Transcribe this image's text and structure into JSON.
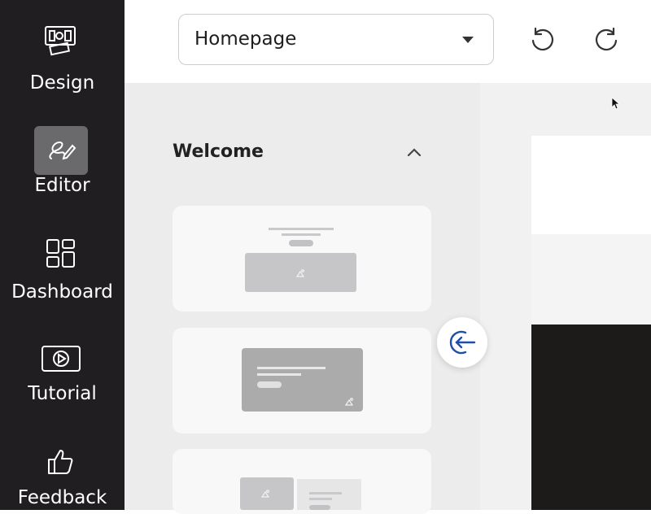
{
  "sidebar": {
    "items": [
      {
        "label": "Design",
        "icon": "design-icon",
        "active": false
      },
      {
        "label": "Editor",
        "icon": "editor-pen-icon",
        "active": true
      },
      {
        "label": "Dashboard",
        "icon": "dashboard-grid-icon",
        "active": false
      },
      {
        "label": "Tutorial",
        "icon": "play-video-icon",
        "active": false
      },
      {
        "label": "Feedback",
        "icon": "thumbs-up-icon",
        "active": false
      }
    ]
  },
  "toolbar": {
    "page_select": {
      "value": "Homepage"
    },
    "undo_icon": "undo-icon",
    "redo_icon": "redo-icon"
  },
  "sections_panel": {
    "title": "Welcome",
    "collapse_icon": "chevron-up-icon",
    "collapse_panel_icon": "arrow-left-circle-icon"
  },
  "colors": {
    "sidebar_bg": "#201e21",
    "active_item_bg": "#6a696b",
    "panel_bg": "#ececed",
    "card_bg": "#f8f8f9",
    "accent_blue": "#1f4fa8"
  }
}
